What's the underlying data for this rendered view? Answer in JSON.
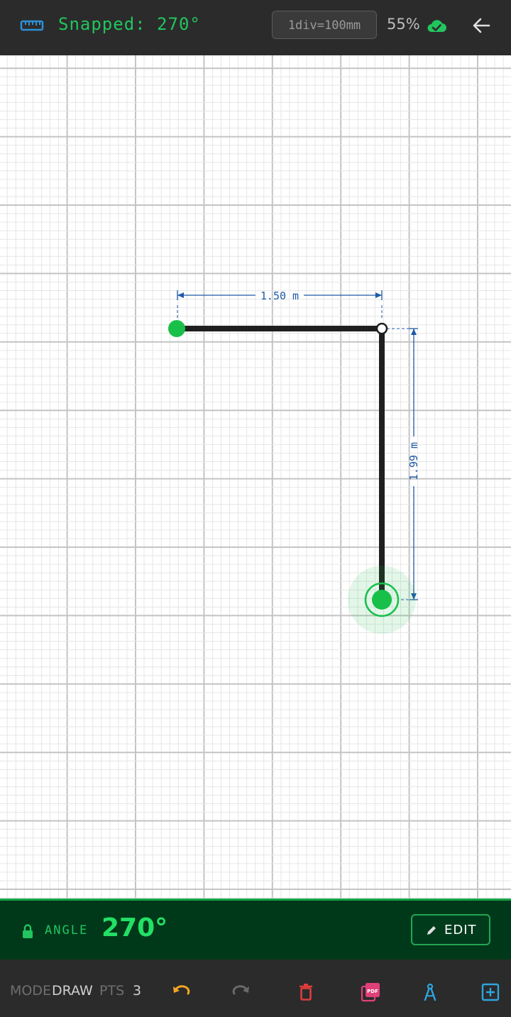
{
  "topbar": {
    "snap_text": "Snapped: 270°",
    "scale": "1div=100mm",
    "zoom": "55%",
    "icons": {
      "ruler": "ruler-icon",
      "cloud": "cloud-check-icon",
      "back": "arrow-left-icon"
    },
    "colors": {
      "snap": "#22c55e",
      "ruler": "#2e8fd6",
      "cloud": "#22c55e"
    }
  },
  "drawing": {
    "horizontal_dimension": "1.50 m",
    "vertical_dimension": "1.99 m",
    "colors": {
      "line": "#1f1f1f",
      "point": "#18c04a",
      "dimension": "#1e5aa8",
      "grid_major": "#c4c4c4",
      "grid_minor": "#e6e6e6"
    }
  },
  "angle_panel": {
    "label": "ANGLE",
    "value": "270°",
    "edit_label": "EDIT",
    "icons": {
      "lock": "lock-icon",
      "edit": "pencil-icon"
    }
  },
  "bottombar": {
    "mode_label": "MODE",
    "mode_value": "DRAW",
    "pts_label": "PTS",
    "pts_value": "3",
    "icons": [
      "undo-icon",
      "redo-icon",
      "trash-icon",
      "pdf-icon",
      "compass-icon",
      "add-box-icon"
    ],
    "colors": {
      "undo": "#f5a623",
      "trash": "#e03c3c",
      "pdf": "#e0407a",
      "compass": "#2ea6e0",
      "add": "#2ea6e0"
    }
  }
}
